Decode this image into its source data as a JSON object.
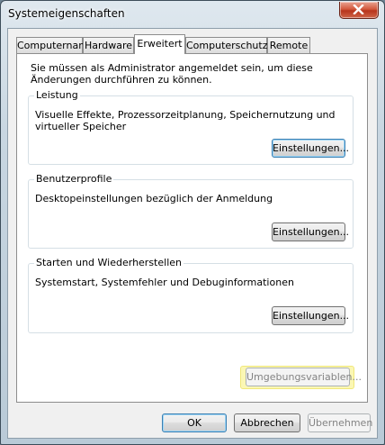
{
  "window": {
    "title": "Systemeigenschaften"
  },
  "tabs": [
    {
      "label": "Computername"
    },
    {
      "label": "Hardware"
    },
    {
      "label": "Erweitert"
    },
    {
      "label": "Computerschutz"
    },
    {
      "label": "Remote"
    }
  ],
  "main": {
    "admin_note": "Sie müssen als Administrator angemeldet sein, um diese Änderungen durchführen zu können.",
    "groups": [
      {
        "title": "Leistung",
        "description": "Visuelle Effekte, Prozessorzeitplanung, Speichernutzung und virtueller Speicher",
        "button": "Einstellungen..."
      },
      {
        "title": "Benutzerprofile",
        "description": "Desktopeinstellungen bezüglich der Anmeldung",
        "button": "Einstellungen..."
      },
      {
        "title": "Starten und Wiederherstellen",
        "description": "Systemstart, Systemfehler und Debuginformationen",
        "button": "Einstellungen..."
      }
    ],
    "env_button": "Umgebungsvariablen..."
  },
  "footer": {
    "ok": "OK",
    "cancel": "Abbrechen",
    "apply": "Übernehmen"
  },
  "icons": {
    "close": "close-icon"
  },
  "colors": {
    "highlight": "#fbf7b4",
    "close_button": "#c8482c",
    "focus_border": "#3c7fb1"
  }
}
